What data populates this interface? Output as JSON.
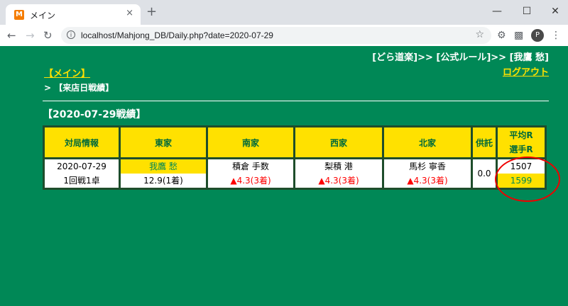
{
  "browser": {
    "tab_title": "メイン",
    "favicon_label": "M",
    "close_glyph": "×",
    "new_tab_glyph": "+",
    "url": "localhost/Mahjong_DB/Daily.php?date=2020-07-29",
    "profile_label": "P"
  },
  "header": {
    "links": "[どら道楽]>> [公式ルール]>> [我鷹 愁]",
    "logout": "ログアウト",
    "menu_link": "【メイン】",
    "breadcrumb": "> 【来店日戦績】"
  },
  "section_title": "【2020-07-29戦績】",
  "table": {
    "headers": [
      "対局情報",
      "東家",
      "南家",
      "西家",
      "北家",
      "供託",
      "平均R",
      "選手R"
    ],
    "row": {
      "date": "2020-07-29",
      "game": "1回戦1卓",
      "east_name": "我鷹 愁",
      "east_score": "12.9(1着)",
      "south_name": "積倉 手数",
      "south_score": "▲4.3(3着)",
      "west_name": "梨積 港",
      "west_score": "▲4.3(3着)",
      "north_name": "馬杉 寧香",
      "north_score": "▲4.3(3着)",
      "deposit": "0.0",
      "avg_rating": "1507",
      "player_rating": "1599"
    }
  },
  "colors": {
    "page_bg": "#008856",
    "header_yellow": "#ffe100",
    "negative_red": "#ff0000",
    "annotation_red": "#e00000"
  }
}
